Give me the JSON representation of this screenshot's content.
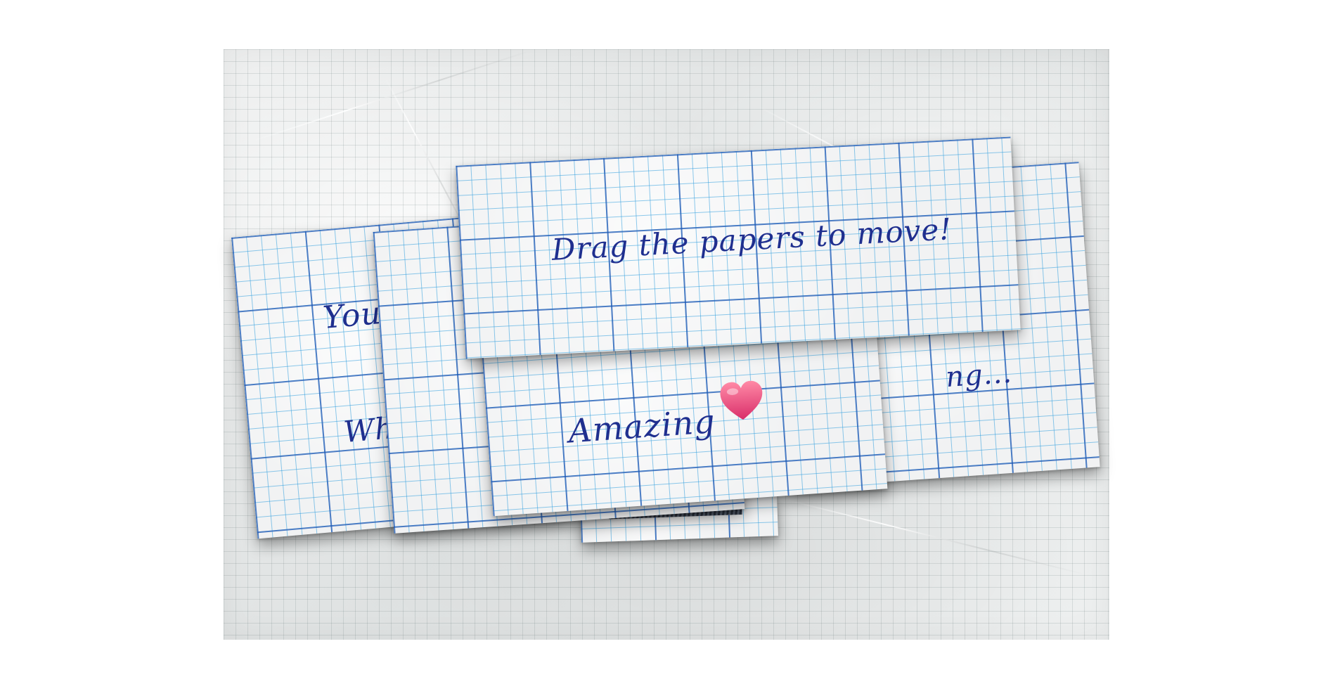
{
  "papers": {
    "drag_hint": "Drag the papers to move!",
    "you_fragment": "You",
    "whe_fragment": "Whe",
    "ing_fragment": "ng...",
    "amazing": "Amazing"
  },
  "icons": {
    "heart": "heart-icon"
  },
  "colors": {
    "ink": "#1f2f8f",
    "grid_major": "#2058b4",
    "grid_minor": "#34a0de",
    "heart_top": "#ff7a9a",
    "heart_bottom": "#d92e6a"
  }
}
